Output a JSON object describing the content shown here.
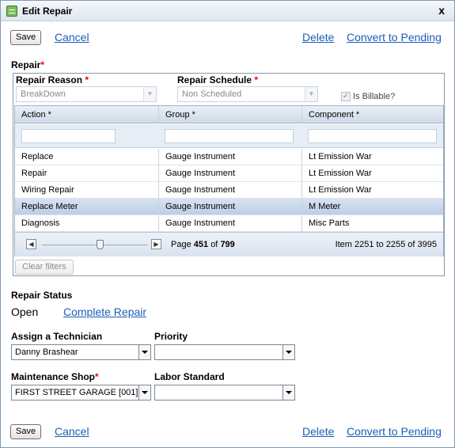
{
  "window": {
    "title": "Edit Repair",
    "close_glyph": "x"
  },
  "toolbar": {
    "save": "Save",
    "cancel": "Cancel",
    "delete": "Delete",
    "convert": "Convert to Pending"
  },
  "repair": {
    "section_label": "Repair",
    "required_mark": "*",
    "reason_label": "Repair Reason",
    "reason_value": "BreakDown",
    "schedule_label": "Repair Schedule",
    "schedule_value": "Non Scheduled",
    "billable_label": "Is Billable?",
    "billable_checked": true
  },
  "grid": {
    "columns": [
      "Action *",
      "Group *",
      "Component *"
    ],
    "rows": [
      [
        "Replace",
        "Gauge Instrument",
        "Lt Emission War"
      ],
      [
        "Repair",
        "Gauge Instrument",
        "Lt Emission War"
      ],
      [
        "Wiring Repair",
        "Gauge Instrument",
        "Lt Emission War"
      ],
      [
        "Replace Meter",
        "Gauge Instrument",
        "M Meter"
      ],
      [
        "Diagnosis",
        "Gauge Instrument",
        "Misc Parts"
      ]
    ],
    "selected_row": 3,
    "pager": {
      "page_prefix": "Page",
      "page": "451",
      "of": "of",
      "total_pages": "799",
      "items_text": "Item 2251 to 2255 of 3995"
    },
    "clear_filters": "Clear filters"
  },
  "status": {
    "label": "Repair Status",
    "value": "Open",
    "complete_link": "Complete Repair"
  },
  "assignment": {
    "technician_label": "Assign a Technician",
    "technician_value": "Danny Brashear",
    "priority_label": "Priority",
    "priority_value": "",
    "shop_label": "Maintenance Shop",
    "shop_value": "FIRST STREET GARAGE [001]",
    "labor_label": "Labor Standard",
    "labor_value": ""
  },
  "colors": {
    "link": "#1a5eb8",
    "required": "#e00000",
    "selected_row": "#c9d8ec"
  }
}
